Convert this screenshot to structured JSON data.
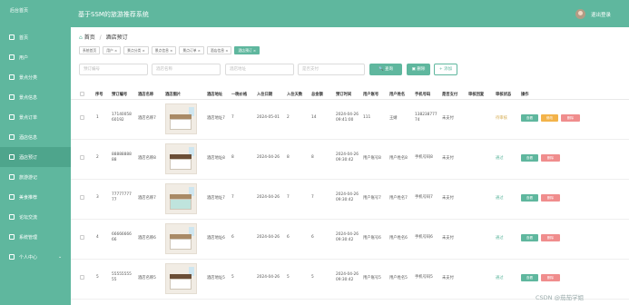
{
  "header": {
    "logo": "后台首页",
    "title": "基于SSM的旅游推荐系统",
    "logout": "退出登录"
  },
  "sidebar": {
    "items": [
      {
        "label": "首页"
      },
      {
        "label": "用户"
      },
      {
        "label": "景点分类"
      },
      {
        "label": "景点信息"
      },
      {
        "label": "景点订单"
      },
      {
        "label": "酒店信息"
      },
      {
        "label": "酒店预订"
      },
      {
        "label": "旅游游记"
      },
      {
        "label": "美食推荐"
      },
      {
        "label": "论坛交流"
      },
      {
        "label": "系统管理"
      },
      {
        "label": "个人中心"
      }
    ]
  },
  "breadcrumb": {
    "home": "首页",
    "current": "酒店预订"
  },
  "tabs": [
    "系统首页",
    "用户 ×",
    "景点分类 ×",
    "景点信息 ×",
    "景点订单 ×",
    "酒店信息 ×",
    "酒店预订 ×"
  ],
  "search": {
    "booking_no": "预订编号",
    "hotel_name": "酒店名称",
    "hotel_addr": "酒店地址",
    "paid": "是否支付",
    "query": "查询",
    "delete": "删除",
    "add": "添加"
  },
  "table": {
    "headers": [
      "序号",
      "预订编号",
      "酒店名称",
      "酒店图片",
      "酒店地址",
      "一晚价格",
      "入住日期",
      "入住天数",
      "总金额",
      "预订时间",
      "用户账号",
      "用户姓名",
      "手机号码",
      "是否支付",
      "审核回复",
      "审核状态",
      "操作"
    ],
    "rows": [
      {
        "no": "1",
        "code": [
          "17140058",
          "60192"
        ],
        "name": "酒店名称7",
        "addr": "酒店地址7",
        "price": "7",
        "date": "2024-05-01",
        "days": "2",
        "total": "14",
        "time": [
          "2024-04-26",
          "09:41:00"
        ],
        "account": "111",
        "uname": "王婧",
        "phone": [
          "138238777",
          "74"
        ],
        "paid": "未支付",
        "reply": "",
        "status": "待审核"
      },
      {
        "no": "2",
        "code": [
          "88888888",
          "88"
        ],
        "name": "酒店名称8",
        "addr": "酒店地址8",
        "price": "8",
        "date": "2024-04-26",
        "days": "8",
        "total": "8",
        "time": [
          "2024-04-26",
          "09:30:42"
        ],
        "account": "用户账号8",
        "uname": "用户姓名8",
        "phone": [
          "手机号码8"
        ],
        "paid": "未支付",
        "reply": "",
        "status": "通过"
      },
      {
        "no": "3",
        "code": [
          "77777777",
          "77"
        ],
        "name": "酒店名称7",
        "addr": "酒店地址7",
        "price": "7",
        "date": "2024-04-26",
        "days": "7",
        "total": "7",
        "time": [
          "2024-04-26",
          "09:30:42"
        ],
        "account": "用户账号7",
        "uname": "用户姓名7",
        "phone": [
          "手机号码7"
        ],
        "paid": "未支付",
        "reply": "",
        "status": "通过"
      },
      {
        "no": "4",
        "code": [
          "66666666",
          "66"
        ],
        "name": "酒店名称6",
        "addr": "酒店地址6",
        "price": "6",
        "date": "2024-04-26",
        "days": "6",
        "total": "6",
        "time": [
          "2024-04-26",
          "09:30:42"
        ],
        "account": "用户账号6",
        "uname": "用户姓名6",
        "phone": [
          "手机号码6"
        ],
        "paid": "未支付",
        "reply": "",
        "status": "通过"
      },
      {
        "no": "5",
        "code": [
          "55555555",
          "55"
        ],
        "name": "酒店名称5",
        "addr": "酒店地址5",
        "price": "5",
        "date": "2024-04-26",
        "days": "5",
        "total": "5",
        "time": [
          "2024-04-26",
          "09:30:42"
        ],
        "account": "用户账号5",
        "uname": "用户姓名5",
        "phone": [
          "手机号码5"
        ],
        "paid": "未支付",
        "reply": "",
        "status": "通过"
      }
    ],
    "actions": {
      "view": "查看",
      "edit": "修改",
      "delete": "删除"
    }
  },
  "watermark": "CSDN @茄茄学姐",
  "colors": {
    "primary": "#5fb79e",
    "warning": "#f3b34a",
    "danger": "#f08d8d"
  }
}
